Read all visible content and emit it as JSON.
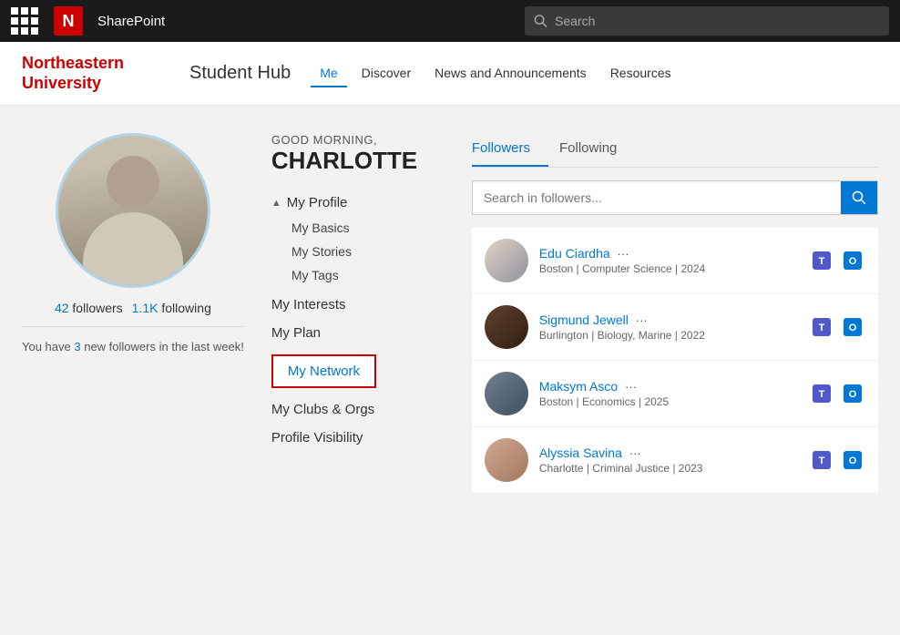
{
  "topbar": {
    "app_name": "SharePoint",
    "logo_letter": "N",
    "search_placeholder": "Search"
  },
  "header": {
    "university_name_line1": "Northeastern",
    "university_name_line2": "University",
    "hub_title": "Student Hub",
    "nav_items": [
      {
        "label": "Me",
        "active": true
      },
      {
        "label": "Discover",
        "active": false
      },
      {
        "label": "News and Announcements",
        "active": false
      },
      {
        "label": "Resources",
        "active": false
      }
    ]
  },
  "profile": {
    "greeting": "GOOD MORNING,",
    "name": "CHARLOTTE",
    "followers_count": "42",
    "following_count": "1.1K",
    "followers_label": "followers",
    "following_label": "following",
    "new_followers_count": "3",
    "new_followers_label": "new followers",
    "new_followers_suffix": "in the last week!"
  },
  "menu": {
    "my_profile_label": "My Profile",
    "my_basics_label": "My Basics",
    "my_stories_label": "My Stories",
    "my_tags_label": "My Tags",
    "my_interests_label": "My Interests",
    "my_plan_label": "My Plan",
    "my_network_label": "My Network",
    "my_clubs_label": "My Clubs & Orgs",
    "profile_visibility_label": "Profile Visibility"
  },
  "followers_panel": {
    "tab_followers": "Followers",
    "tab_following": "Following",
    "search_placeholder": "Search in followers...",
    "followers": [
      {
        "name": "Edu Ciardha",
        "details": "Boston | Computer Science | 2024",
        "avatar_class": "fa1"
      },
      {
        "name": "Sigmund Jewell",
        "details": "Burlington | Biology, Marine | 2022",
        "avatar_class": "fa2"
      },
      {
        "name": "Maksym Asco",
        "details": "Boston | Economics | 2025",
        "avatar_class": "fa3"
      },
      {
        "name": "Alyssia Savina",
        "details": "Charlotte | Criminal Justice | 2023",
        "avatar_class": "fa4"
      }
    ],
    "more_indicator": "···"
  }
}
